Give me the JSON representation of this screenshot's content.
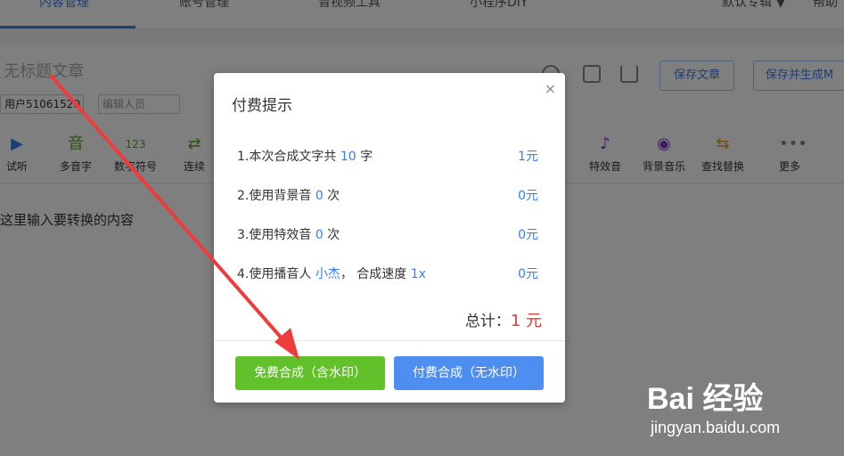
{
  "topnav": {
    "tabs": [
      {
        "label": "内容管理"
      },
      {
        "label": "账号管理"
      },
      {
        "label": "音视频工具"
      },
      {
        "label": "小程序DIY"
      }
    ],
    "album": "默认专辑",
    "help": "帮助"
  },
  "editor": {
    "title_placeholder": "无标题文章",
    "user_value": "用户51061520",
    "editor_placeholder": "编辑人员",
    "save_label": "保存文章",
    "save_gen_label": "保存并生成M",
    "content_placeholder": "这里输入要转换的内容"
  },
  "toolbar": {
    "items": [
      {
        "label": "试听"
      },
      {
        "label": "多音字"
      },
      {
        "label": "数字符号"
      },
      {
        "label": "连续"
      },
      {
        "label": "特效音"
      },
      {
        "label": "背景音乐"
      },
      {
        "label": "查找替换"
      },
      {
        "label": "更多"
      }
    ]
  },
  "modal": {
    "title": "付费提示",
    "close": "×",
    "rows": [
      {
        "prefix": "1.本次合成文字共 ",
        "value": "10",
        "suffix": " 字",
        "price": "1元"
      },
      {
        "prefix": "2.使用背景音 ",
        "value": "0",
        "suffix": " 次",
        "price": "0元"
      },
      {
        "prefix": "3.使用特效音 ",
        "value": "0",
        "suffix": " 次",
        "price": "0元"
      },
      {
        "prefix": "4.使用播音人 ",
        "value": "小杰",
        "mid": "， 合成速度 ",
        "value2": "1x",
        "price": "0元"
      }
    ],
    "total_label": "总计：",
    "total_value": "1 元",
    "free_button": "免费合成（含水印）",
    "paid_button": "付费合成（无水印）"
  },
  "watermark": {
    "logo": "Bai 经验",
    "url": "jingyan.baidu.com"
  },
  "colors": {
    "accent_blue": "#3a7df0",
    "green": "#62c02b",
    "red": "#e53935",
    "arrow_red": "#ee3b3b"
  }
}
